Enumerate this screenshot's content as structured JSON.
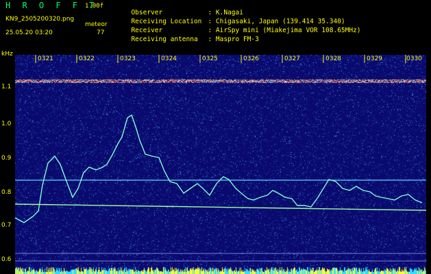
{
  "header": {
    "brand": "H R O F F T",
    "version": "1.00f",
    "filename": "KN9_2505200320.png",
    "meteor_label": "meteor",
    "datetime": "25.05.20 03:20",
    "count": "77"
  },
  "info": [
    {
      "key": "Observer",
      "value": ": K.Nagai"
    },
    {
      "key": "Receiving Location",
      "value": ": Chigasaki, Japan (139.414 35.340)"
    },
    {
      "key": "Receiver",
      "value": ": AirSpy mini (Miakejima VOR 108.65MHz)"
    },
    {
      "key": "Receiving antenna",
      "value": ": Maspro FM-3"
    }
  ],
  "axis": {
    "unit_label": "kHz",
    "y_ticks": [
      "1.1",
      "1.0",
      "0.9",
      "0.8",
      "0.7",
      "0.6"
    ],
    "time_ticks": [
      "0321",
      "0322",
      "0323",
      "0324",
      "0325",
      "0326",
      "0327",
      "0328",
      "0329",
      "0330"
    ]
  },
  "colors": {
    "background": "#0a0a6e",
    "text": "#ffff00",
    "brand": "#00ff66",
    "trace": "#7fffd4",
    "noise_band": "#ff6666"
  }
}
